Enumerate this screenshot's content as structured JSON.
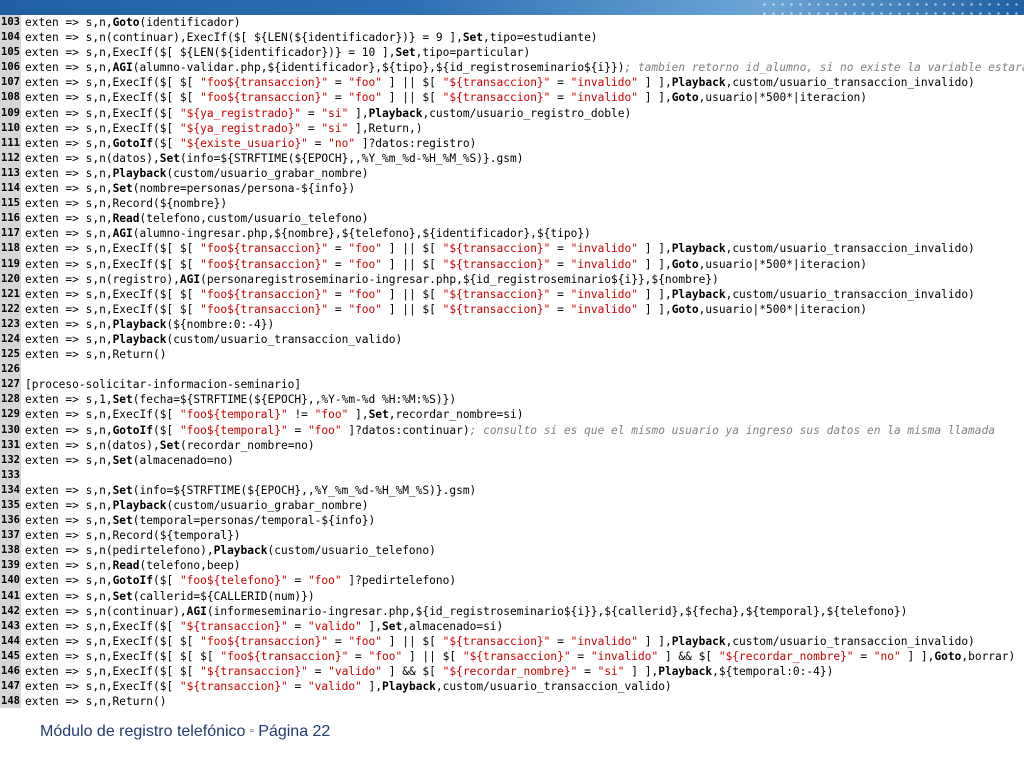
{
  "footer": {
    "module": "Módulo de registro telefónico",
    "separator": "▫",
    "page": "Página 22"
  },
  "lines": [
    {
      "n": "103",
      "parts": [
        [
          "t",
          "exten => s,n,"
        ],
        [
          "k",
          "Goto"
        ],
        [
          "t",
          "(identificador)"
        ]
      ]
    },
    {
      "n": "104",
      "parts": [
        [
          "t",
          "exten => s,n(continuar),ExecIf($[ ${LEN(${identificador})} = 9 ],"
        ],
        [
          "k",
          "Set"
        ],
        [
          "t",
          ",tipo=estudiante)"
        ]
      ]
    },
    {
      "n": "105",
      "parts": [
        [
          "t",
          "exten => s,n,ExecIf($[ ${LEN(${identificador})} = 10 ],"
        ],
        [
          "k",
          "Set"
        ],
        [
          "t",
          ",tipo=particular)"
        ]
      ]
    },
    {
      "n": "106",
      "parts": [
        [
          "t",
          "exten => s,n,"
        ],
        [
          "k",
          "AGI"
        ],
        [
          "t",
          "(alumno-validar.php,${identificador},${tipo},${id_registroseminario${i}})"
        ],
        [
          "c",
          "; tambien retorno id_alumno, si no existe la variable estara"
        ]
      ]
    },
    {
      "n": "107",
      "parts": [
        [
          "t",
          "exten => s,n,ExecIf($[ $[ "
        ],
        [
          "s",
          "\"foo${transaccion}\""
        ],
        [
          "t",
          " = "
        ],
        [
          "s",
          "\"foo\""
        ],
        [
          "t",
          " ] || $[ "
        ],
        [
          "s",
          "\"${transaccion}\""
        ],
        [
          "t",
          " = "
        ],
        [
          "s",
          "\"invalido\""
        ],
        [
          "t",
          " ] ],"
        ],
        [
          "k",
          "Playback"
        ],
        [
          "t",
          ",custom/usuario_transaccion_invalido)"
        ]
      ]
    },
    {
      "n": "108",
      "parts": [
        [
          "t",
          "exten => s,n,ExecIf($[ $[ "
        ],
        [
          "s",
          "\"foo${transaccion}\""
        ],
        [
          "t",
          " = "
        ],
        [
          "s",
          "\"foo\""
        ],
        [
          "t",
          " ] || $[ "
        ],
        [
          "s",
          "\"${transaccion}\""
        ],
        [
          "t",
          " = "
        ],
        [
          "s",
          "\"invalido\""
        ],
        [
          "t",
          " ] ],"
        ],
        [
          "k",
          "Goto"
        ],
        [
          "t",
          ",usuario|*500*|iteracion)"
        ]
      ]
    },
    {
      "n": "109",
      "parts": [
        [
          "t",
          "exten => s,n,ExecIf($[ "
        ],
        [
          "s",
          "\"${ya_registrado}\""
        ],
        [
          "t",
          " = "
        ],
        [
          "s",
          "\"si\""
        ],
        [
          "t",
          " ],"
        ],
        [
          "k",
          "Playback"
        ],
        [
          "t",
          ",custom/usuario_registro_doble)"
        ]
      ]
    },
    {
      "n": "110",
      "parts": [
        [
          "t",
          "exten => s,n,ExecIf($[ "
        ],
        [
          "s",
          "\"${ya_registrado}\""
        ],
        [
          "t",
          " = "
        ],
        [
          "s",
          "\"si\""
        ],
        [
          "t",
          " ],Return,)"
        ]
      ]
    },
    {
      "n": "111",
      "parts": [
        [
          "t",
          "exten => s,n,"
        ],
        [
          "k",
          "GotoIf"
        ],
        [
          "t",
          "($[ "
        ],
        [
          "s",
          "\"${existe_usuario}\""
        ],
        [
          "t",
          " = "
        ],
        [
          "s",
          "\"no\""
        ],
        [
          "t",
          " ]?datos:registro)"
        ]
      ]
    },
    {
      "n": "112",
      "parts": [
        [
          "t",
          "exten => s,n(datos),"
        ],
        [
          "k",
          "Set"
        ],
        [
          "t",
          "(info=${STRFTIME(${EPOCH},,%Y_%m_%d-%H_%M_%S)}.gsm)"
        ]
      ]
    },
    {
      "n": "113",
      "parts": [
        [
          "t",
          "exten => s,n,"
        ],
        [
          "k",
          "Playback"
        ],
        [
          "t",
          "(custom/usuario_grabar_nombre)"
        ]
      ]
    },
    {
      "n": "114",
      "parts": [
        [
          "t",
          "exten => s,n,"
        ],
        [
          "k",
          "Set"
        ],
        [
          "t",
          "(nombre=personas/persona-${info})"
        ]
      ]
    },
    {
      "n": "115",
      "parts": [
        [
          "t",
          "exten => s,n,Record(${nombre})"
        ]
      ]
    },
    {
      "n": "116",
      "parts": [
        [
          "t",
          "exten => s,n,"
        ],
        [
          "k",
          "Read"
        ],
        [
          "t",
          "(telefono,custom/usuario_telefono)"
        ]
      ]
    },
    {
      "n": "117",
      "parts": [
        [
          "t",
          "exten => s,n,"
        ],
        [
          "k",
          "AGI"
        ],
        [
          "t",
          "(alumno-ingresar.php,${nombre},${telefono},${identificador},${tipo})"
        ]
      ]
    },
    {
      "n": "118",
      "parts": [
        [
          "t",
          "exten => s,n,ExecIf($[ $[ "
        ],
        [
          "s",
          "\"foo${transaccion}\""
        ],
        [
          "t",
          " = "
        ],
        [
          "s",
          "\"foo\""
        ],
        [
          "t",
          " ] || $[ "
        ],
        [
          "s",
          "\"${transaccion}\""
        ],
        [
          "t",
          " = "
        ],
        [
          "s",
          "\"invalido\""
        ],
        [
          "t",
          " ] ],"
        ],
        [
          "k",
          "Playback"
        ],
        [
          "t",
          ",custom/usuario_transaccion_invalido)"
        ]
      ]
    },
    {
      "n": "119",
      "parts": [
        [
          "t",
          "exten => s,n,ExecIf($[ $[ "
        ],
        [
          "s",
          "\"foo${transaccion}\""
        ],
        [
          "t",
          " = "
        ],
        [
          "s",
          "\"foo\""
        ],
        [
          "t",
          " ] || $[ "
        ],
        [
          "s",
          "\"${transaccion}\""
        ],
        [
          "t",
          " = "
        ],
        [
          "s",
          "\"invalido\""
        ],
        [
          "t",
          " ] ],"
        ],
        [
          "k",
          "Goto"
        ],
        [
          "t",
          ",usuario|*500*|iteracion)"
        ]
      ]
    },
    {
      "n": "120",
      "parts": [
        [
          "t",
          "exten => s,n(registro),"
        ],
        [
          "k",
          "AGI"
        ],
        [
          "t",
          "(personaregistroseminario-ingresar.php,${id_registroseminario${i}},${nombre})"
        ]
      ]
    },
    {
      "n": "121",
      "parts": [
        [
          "t",
          "exten => s,n,ExecIf($[ $[ "
        ],
        [
          "s",
          "\"foo${transaccion}\""
        ],
        [
          "t",
          " = "
        ],
        [
          "s",
          "\"foo\""
        ],
        [
          "t",
          " ] || $[ "
        ],
        [
          "s",
          "\"${transaccion}\""
        ],
        [
          "t",
          " = "
        ],
        [
          "s",
          "\"invalido\""
        ],
        [
          "t",
          " ] ],"
        ],
        [
          "k",
          "Playback"
        ],
        [
          "t",
          ",custom/usuario_transaccion_invalido)"
        ]
      ]
    },
    {
      "n": "122",
      "parts": [
        [
          "t",
          "exten => s,n,ExecIf($[ $[ "
        ],
        [
          "s",
          "\"foo${transaccion}\""
        ],
        [
          "t",
          " = "
        ],
        [
          "s",
          "\"foo\""
        ],
        [
          "t",
          " ] || $[ "
        ],
        [
          "s",
          "\"${transaccion}\""
        ],
        [
          "t",
          " = "
        ],
        [
          "s",
          "\"invalido\""
        ],
        [
          "t",
          " ] ],"
        ],
        [
          "k",
          "Goto"
        ],
        [
          "t",
          ",usuario|*500*|iteracion)"
        ]
      ]
    },
    {
      "n": "123",
      "parts": [
        [
          "t",
          "exten => s,n,"
        ],
        [
          "k",
          "Playback"
        ],
        [
          "t",
          "(${nombre:0:-4})"
        ]
      ]
    },
    {
      "n": "124",
      "parts": [
        [
          "t",
          "exten => s,n,"
        ],
        [
          "k",
          "Playback"
        ],
        [
          "t",
          "(custom/usuario_transaccion_valido)"
        ]
      ]
    },
    {
      "n": "125",
      "parts": [
        [
          "t",
          "exten => s,n,Return()"
        ]
      ]
    },
    {
      "n": "126",
      "parts": []
    },
    {
      "n": "127",
      "parts": [
        [
          "t",
          "[proceso-solicitar-informacion-seminario]"
        ]
      ]
    },
    {
      "n": "128",
      "parts": [
        [
          "t",
          "exten => s,1,"
        ],
        [
          "k",
          "Set"
        ],
        [
          "t",
          "(fecha=${STRFTIME(${EPOCH},,%Y-%m-%d %H:%M:%S)})"
        ]
      ]
    },
    {
      "n": "129",
      "parts": [
        [
          "t",
          "exten => s,n,ExecIf($[ "
        ],
        [
          "s",
          "\"foo${temporal}\""
        ],
        [
          "t",
          " != "
        ],
        [
          "s",
          "\"foo\""
        ],
        [
          "t",
          " ],"
        ],
        [
          "k",
          "Set"
        ],
        [
          "t",
          ",recordar_nombre=si)"
        ]
      ]
    },
    {
      "n": "130",
      "parts": [
        [
          "t",
          "exten => s,n,"
        ],
        [
          "k",
          "GotoIf"
        ],
        [
          "t",
          "($[ "
        ],
        [
          "s",
          "\"foo${temporal}\""
        ],
        [
          "t",
          " = "
        ],
        [
          "s",
          "\"foo\""
        ],
        [
          "t",
          " ]?datos:continuar)"
        ],
        [
          "c",
          "; consulto si es que el mismo usuario ya ingreso sus datos en la misma llamada"
        ]
      ]
    },
    {
      "n": "131",
      "parts": [
        [
          "t",
          "exten => s,n(datos),"
        ],
        [
          "k",
          "Set"
        ],
        [
          "t",
          "(recordar_nombre=no)"
        ]
      ]
    },
    {
      "n": "132",
      "parts": [
        [
          "t",
          "exten => s,n,"
        ],
        [
          "k",
          "Set"
        ],
        [
          "t",
          "(almacenado=no)"
        ]
      ]
    },
    {
      "n": "133",
      "parts": []
    },
    {
      "n": "134",
      "parts": [
        [
          "t",
          "exten => s,n,"
        ],
        [
          "k",
          "Set"
        ],
        [
          "t",
          "(info=${STRFTIME(${EPOCH},,%Y_%m_%d-%H_%M_%S)}.gsm)"
        ]
      ]
    },
    {
      "n": "135",
      "parts": [
        [
          "t",
          "exten => s,n,"
        ],
        [
          "k",
          "Playback"
        ],
        [
          "t",
          "(custom/usuario_grabar_nombre)"
        ]
      ]
    },
    {
      "n": "136",
      "parts": [
        [
          "t",
          "exten => s,n,"
        ],
        [
          "k",
          "Set"
        ],
        [
          "t",
          "(temporal=personas/temporal-${info})"
        ]
      ]
    },
    {
      "n": "137",
      "parts": [
        [
          "t",
          "exten => s,n,Record(${temporal})"
        ]
      ]
    },
    {
      "n": "138",
      "parts": [
        [
          "t",
          "exten => s,n(pedirtelefono),"
        ],
        [
          "k",
          "Playback"
        ],
        [
          "t",
          "(custom/usuario_telefono)"
        ]
      ]
    },
    {
      "n": "139",
      "parts": [
        [
          "t",
          "exten => s,n,"
        ],
        [
          "k",
          "Read"
        ],
        [
          "t",
          "(telefono,beep)"
        ]
      ]
    },
    {
      "n": "140",
      "parts": [
        [
          "t",
          "exten => s,n,"
        ],
        [
          "k",
          "GotoIf"
        ],
        [
          "t",
          "($[ "
        ],
        [
          "s",
          "\"foo${telefono}\""
        ],
        [
          "t",
          " = "
        ],
        [
          "s",
          "\"foo\""
        ],
        [
          "t",
          " ]?pedirtelefono)"
        ]
      ]
    },
    {
      "n": "141",
      "parts": [
        [
          "t",
          "exten => s,n,"
        ],
        [
          "k",
          "Set"
        ],
        [
          "t",
          "(callerid=${CALLERID(num)})"
        ]
      ]
    },
    {
      "n": "142",
      "parts": [
        [
          "t",
          "exten => s,n(continuar),"
        ],
        [
          "k",
          "AGI"
        ],
        [
          "t",
          "(informeseminario-ingresar.php,${id_registroseminario${i}},${callerid},${fecha},${temporal},${telefono})"
        ]
      ]
    },
    {
      "n": "143",
      "parts": [
        [
          "t",
          "exten => s,n,ExecIf($[ "
        ],
        [
          "s",
          "\"${transaccion}\""
        ],
        [
          "t",
          " = "
        ],
        [
          "s",
          "\"valido\""
        ],
        [
          "t",
          " ],"
        ],
        [
          "k",
          "Set"
        ],
        [
          "t",
          ",almacenado=si)"
        ]
      ]
    },
    {
      "n": "144",
      "parts": [
        [
          "t",
          "exten => s,n,ExecIf($[ $[ "
        ],
        [
          "s",
          "\"foo${transaccion}\""
        ],
        [
          "t",
          " = "
        ],
        [
          "s",
          "\"foo\""
        ],
        [
          "t",
          " ] || $[ "
        ],
        [
          "s",
          "\"${transaccion}\""
        ],
        [
          "t",
          " = "
        ],
        [
          "s",
          "\"invalido\""
        ],
        [
          "t",
          " ] ],"
        ],
        [
          "k",
          "Playback"
        ],
        [
          "t",
          ",custom/usuario_transaccion_invalido)"
        ]
      ]
    },
    {
      "n": "145",
      "parts": [
        [
          "t",
          "exten => s,n,ExecIf($[ $[ $[ "
        ],
        [
          "s",
          "\"foo${transaccion}\""
        ],
        [
          "t",
          " = "
        ],
        [
          "s",
          "\"foo\""
        ],
        [
          "t",
          " ] || $[ "
        ],
        [
          "s",
          "\"${transaccion}\""
        ],
        [
          "t",
          " = "
        ],
        [
          "s",
          "\"invalido\""
        ],
        [
          "t",
          " ] && $[ "
        ],
        [
          "s",
          "\"${recordar_nombre}\""
        ],
        [
          "t",
          " = "
        ],
        [
          "s",
          "\"no\""
        ],
        [
          "t",
          " ] ],"
        ],
        [
          "k",
          "Goto"
        ],
        [
          "t",
          ",borrar)"
        ]
      ]
    },
    {
      "n": "146",
      "parts": [
        [
          "t",
          "exten => s,n,ExecIf($[ $[ "
        ],
        [
          "s",
          "\"${transaccion}\""
        ],
        [
          "t",
          " = "
        ],
        [
          "s",
          "\"valido\""
        ],
        [
          "t",
          " ] && $[ "
        ],
        [
          "s",
          "\"${recordar_nombre}\""
        ],
        [
          "t",
          " = "
        ],
        [
          "s",
          "\"si\""
        ],
        [
          "t",
          " ] ],"
        ],
        [
          "k",
          "Playback"
        ],
        [
          "t",
          ",${temporal:0:-4})"
        ]
      ]
    },
    {
      "n": "147",
      "parts": [
        [
          "t",
          "exten => s,n,ExecIf($[ "
        ],
        [
          "s",
          "\"${transaccion}\""
        ],
        [
          "t",
          " = "
        ],
        [
          "s",
          "\"valido\""
        ],
        [
          "t",
          " ],"
        ],
        [
          "k",
          "Playback"
        ],
        [
          "t",
          ",custom/usuario_transaccion_valido)"
        ]
      ]
    },
    {
      "n": "148",
      "parts": [
        [
          "t",
          "exten => s,n,Return()"
        ]
      ]
    }
  ]
}
